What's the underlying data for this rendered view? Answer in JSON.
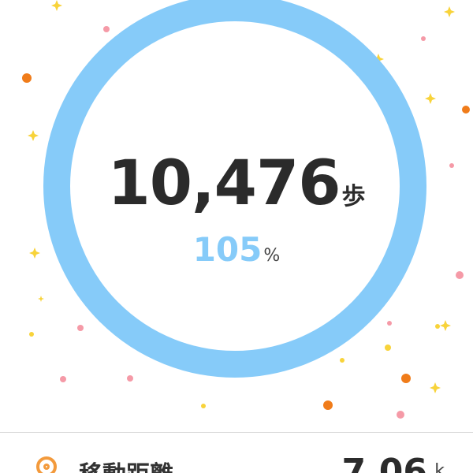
{
  "summary": {
    "steps_value": "10,476",
    "steps_unit": "歩",
    "goal_percent_value": "105",
    "goal_percent_sign": "%",
    "goal_progress": 1.05
  },
  "distance_row": {
    "icon": "location-pin-icon",
    "label": "移動距離",
    "value": "7.06",
    "unit": "k"
  },
  "colors": {
    "ring": "#86cbf9",
    "accent_orange": "#f39a3c",
    "confetti_orange": "#f07c1a",
    "confetti_pink": "#f59aa7",
    "confetti_yellow": "#f8d33a",
    "text_dark": "#2b2b2b"
  }
}
